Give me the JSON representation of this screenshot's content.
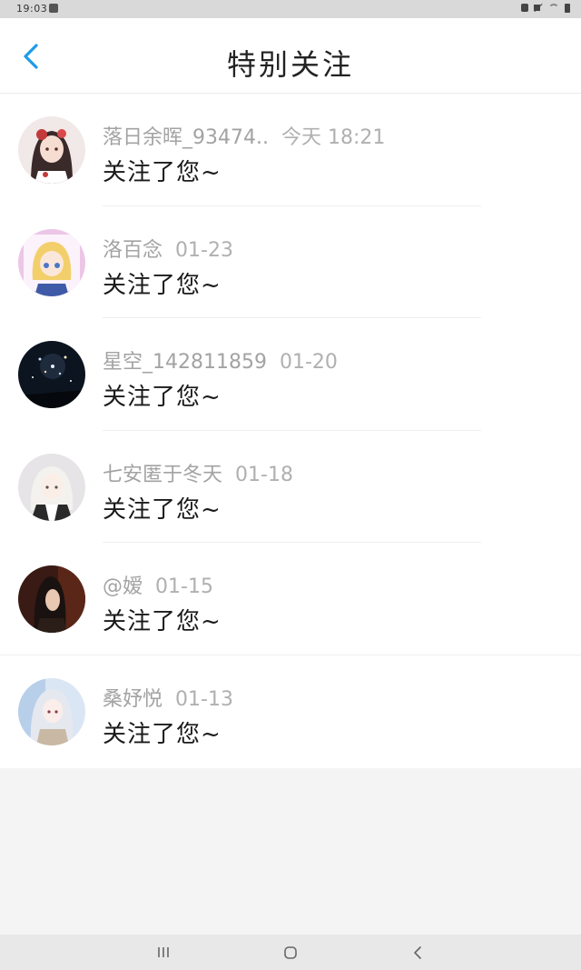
{
  "status_bar": {
    "time": "19:03",
    "icons": [
      "app-icon",
      "lock-icon",
      "mute-icon",
      "wifi-icon",
      "battery-icon"
    ]
  },
  "header": {
    "title": "特别关注",
    "back_icon": "chevron-left-icon",
    "accent_color": "#1e9be8"
  },
  "notifications": [
    {
      "name": "落日余晖_93474..",
      "date": "今天 18:21",
      "message": "关注了您~",
      "avatar": "avatar-red-hair-ornament"
    },
    {
      "name": "洛百念",
      "date": "01-23",
      "message": "关注了您~",
      "avatar": "avatar-blonde-girl-pink-bg"
    },
    {
      "name": "星空_142811859",
      "date": "01-20",
      "message": "关注了您~",
      "avatar": "avatar-night-sky-fireworks"
    },
    {
      "name": "七安匿于冬天",
      "date": "01-18",
      "message": "关注了您~",
      "avatar": "avatar-white-hair-sketch"
    },
    {
      "name": "@嫒",
      "date": "01-15",
      "message": "关注了您~",
      "avatar": "avatar-dark-haired-figure"
    },
    {
      "name": "桑妤悦",
      "date": "01-13",
      "message": "关注了您~",
      "avatar": "avatar-silver-hair-blue-bg"
    }
  ],
  "nav_bar": {
    "icons": [
      "recent-apps-icon",
      "home-icon",
      "back-icon"
    ]
  }
}
